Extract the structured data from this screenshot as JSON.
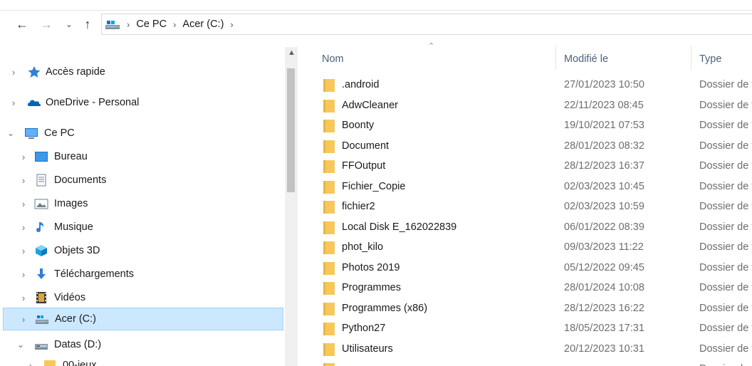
{
  "address_bar": {
    "back_icon": "arrow-left-icon",
    "forward_icon": "arrow-right-icon",
    "recent_icon": "chevron-down-icon",
    "up_icon": "arrow-up-icon",
    "path": [
      "Ce PC",
      "Acer (C:)"
    ],
    "separator": "›"
  },
  "navigation": {
    "items": [
      {
        "label": "Accès rapide",
        "icon": "star-icon",
        "expanded": false
      },
      {
        "label": "OneDrive - Personal",
        "icon": "cloud-icon",
        "expanded": false
      },
      {
        "label": "Ce PC",
        "icon": "computer-icon",
        "expanded": true
      },
      {
        "label": "Bureau",
        "icon": "desktop-icon",
        "expanded": false
      },
      {
        "label": "Documents",
        "icon": "document-icon",
        "expanded": false
      },
      {
        "label": "Images",
        "icon": "pictures-icon",
        "expanded": false
      },
      {
        "label": "Musique",
        "icon": "music-icon",
        "expanded": false
      },
      {
        "label": "Objets 3D",
        "icon": "cube-icon",
        "expanded": false
      },
      {
        "label": "Téléchargements",
        "icon": "download-icon",
        "expanded": false
      },
      {
        "label": "Vidéos",
        "icon": "video-icon",
        "expanded": false
      },
      {
        "label": "Acer (C:)",
        "icon": "drive-icon",
        "expanded": false,
        "selected": true
      },
      {
        "label": "Datas (D:)",
        "icon": "drive-icon",
        "expanded": true
      },
      {
        "label": "00-jeux",
        "icon": "folder-icon",
        "expanded": false
      }
    ]
  },
  "file_list": {
    "columns": {
      "name": "Nom",
      "modified": "Modifié le",
      "type": "Type"
    },
    "rows": [
      {
        "name": ".android",
        "modified": "27/01/2023 10:50",
        "type": "Dossier de fichiers"
      },
      {
        "name": "AdwCleaner",
        "modified": "22/11/2023 08:45",
        "type": "Dossier de fichiers"
      },
      {
        "name": "Boonty",
        "modified": "19/10/2021 07:53",
        "type": "Dossier de fichiers"
      },
      {
        "name": "Document",
        "modified": "28/01/2023 08:32",
        "type": "Dossier de fichiers"
      },
      {
        "name": "FFOutput",
        "modified": "28/12/2023 16:37",
        "type": "Dossier de fichiers"
      },
      {
        "name": "Fichier_Copie",
        "modified": "02/03/2023 10:45",
        "type": "Dossier de fichiers"
      },
      {
        "name": "fichier2",
        "modified": "02/03/2023 10:59",
        "type": "Dossier de fichiers"
      },
      {
        "name": "Local Disk E_162022839",
        "modified": "06/01/2022 08:39",
        "type": "Dossier de fichiers"
      },
      {
        "name": "phot_kilo",
        "modified": "09/03/2023 11:22",
        "type": "Dossier de fichiers"
      },
      {
        "name": "Photos 2019",
        "modified": "05/12/2022 09:45",
        "type": "Dossier de fichiers"
      },
      {
        "name": "Programmes",
        "modified": "28/01/2024 10:08",
        "type": "Dossier de fichiers"
      },
      {
        "name": "Programmes (x86)",
        "modified": "28/12/2023 16:22",
        "type": "Dossier de fichiers"
      },
      {
        "name": "Python27",
        "modified": "18/05/2023 17:31",
        "type": "Dossier de fichiers"
      },
      {
        "name": "Utilisateurs",
        "modified": "20/12/2023 10:31",
        "type": "Dossier de fichiers"
      },
      {
        "name": "",
        "modified": "",
        "type": "Dossier de fichiers"
      }
    ]
  },
  "colors": {
    "selection_bg": "#cce8ff",
    "folder": "#f6c85a",
    "header_text": "#4c607a"
  }
}
